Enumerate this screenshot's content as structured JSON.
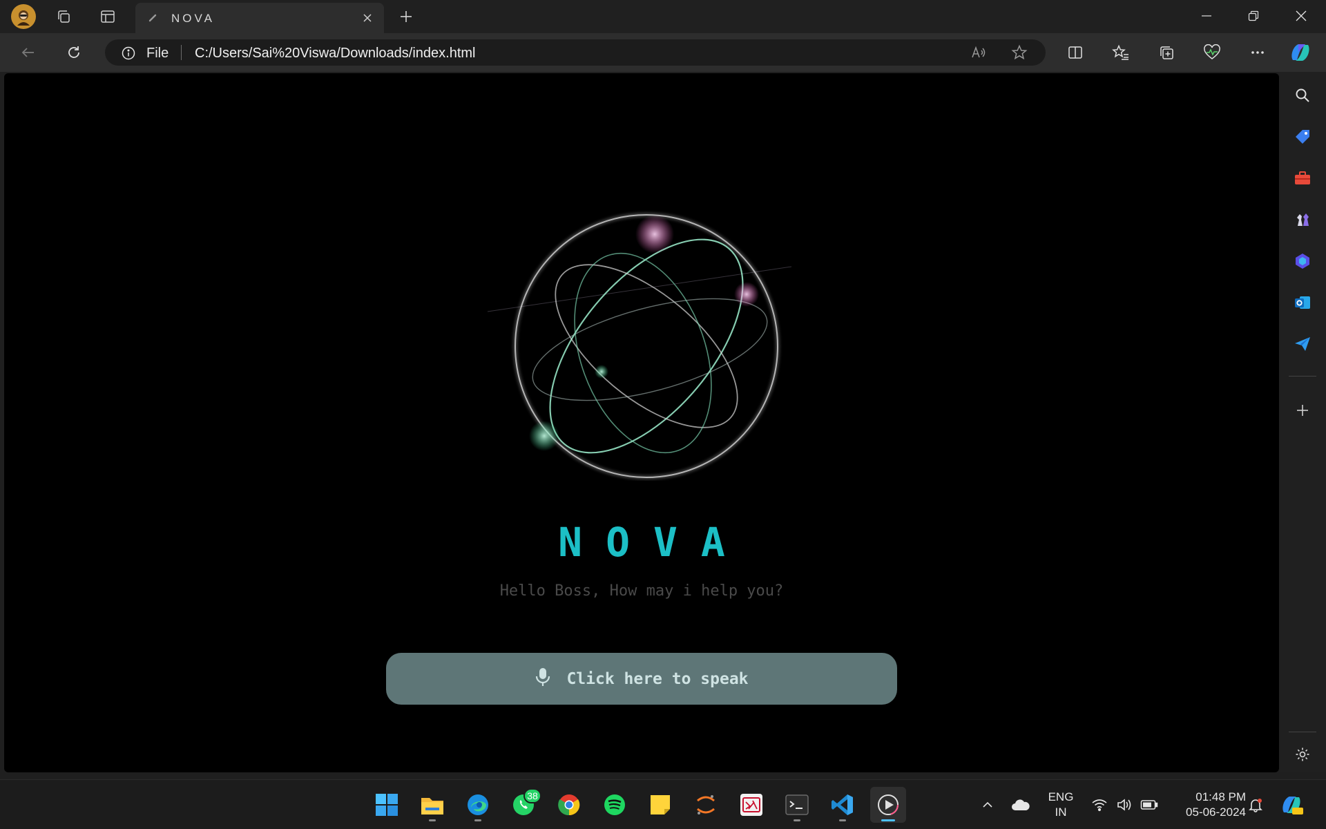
{
  "browser": {
    "tab": {
      "title": "NOVA"
    },
    "address": {
      "scheme_label": "File",
      "url": "C:/Users/Sai%20Viswa/Downloads/index.html"
    }
  },
  "page": {
    "title": "NOVA",
    "greeting": "Hello Boss, How may i help you?",
    "speak_button_label": "Click here to speak",
    "accent_color": "#1cbfc6",
    "button_color": "#5e7677"
  },
  "sidebar": {
    "items": [
      "search-icon",
      "tag-icon",
      "toolbox-icon",
      "chess-icon",
      "copilot-designer-icon",
      "outlook-icon",
      "send-icon",
      "add-icon"
    ],
    "settings": "gear-icon"
  },
  "taskbar": {
    "apps": [
      "start",
      "file-explorer",
      "edge",
      "whatsapp",
      "chrome",
      "spotify",
      "sticky-notes",
      "jupyter",
      "keyboard-app",
      "terminal",
      "vscode",
      "media-player"
    ],
    "whatsapp_badge": "38",
    "language": {
      "line1": "ENG",
      "line2": "IN"
    },
    "time": "01:48 PM",
    "date": "05-06-2024"
  }
}
